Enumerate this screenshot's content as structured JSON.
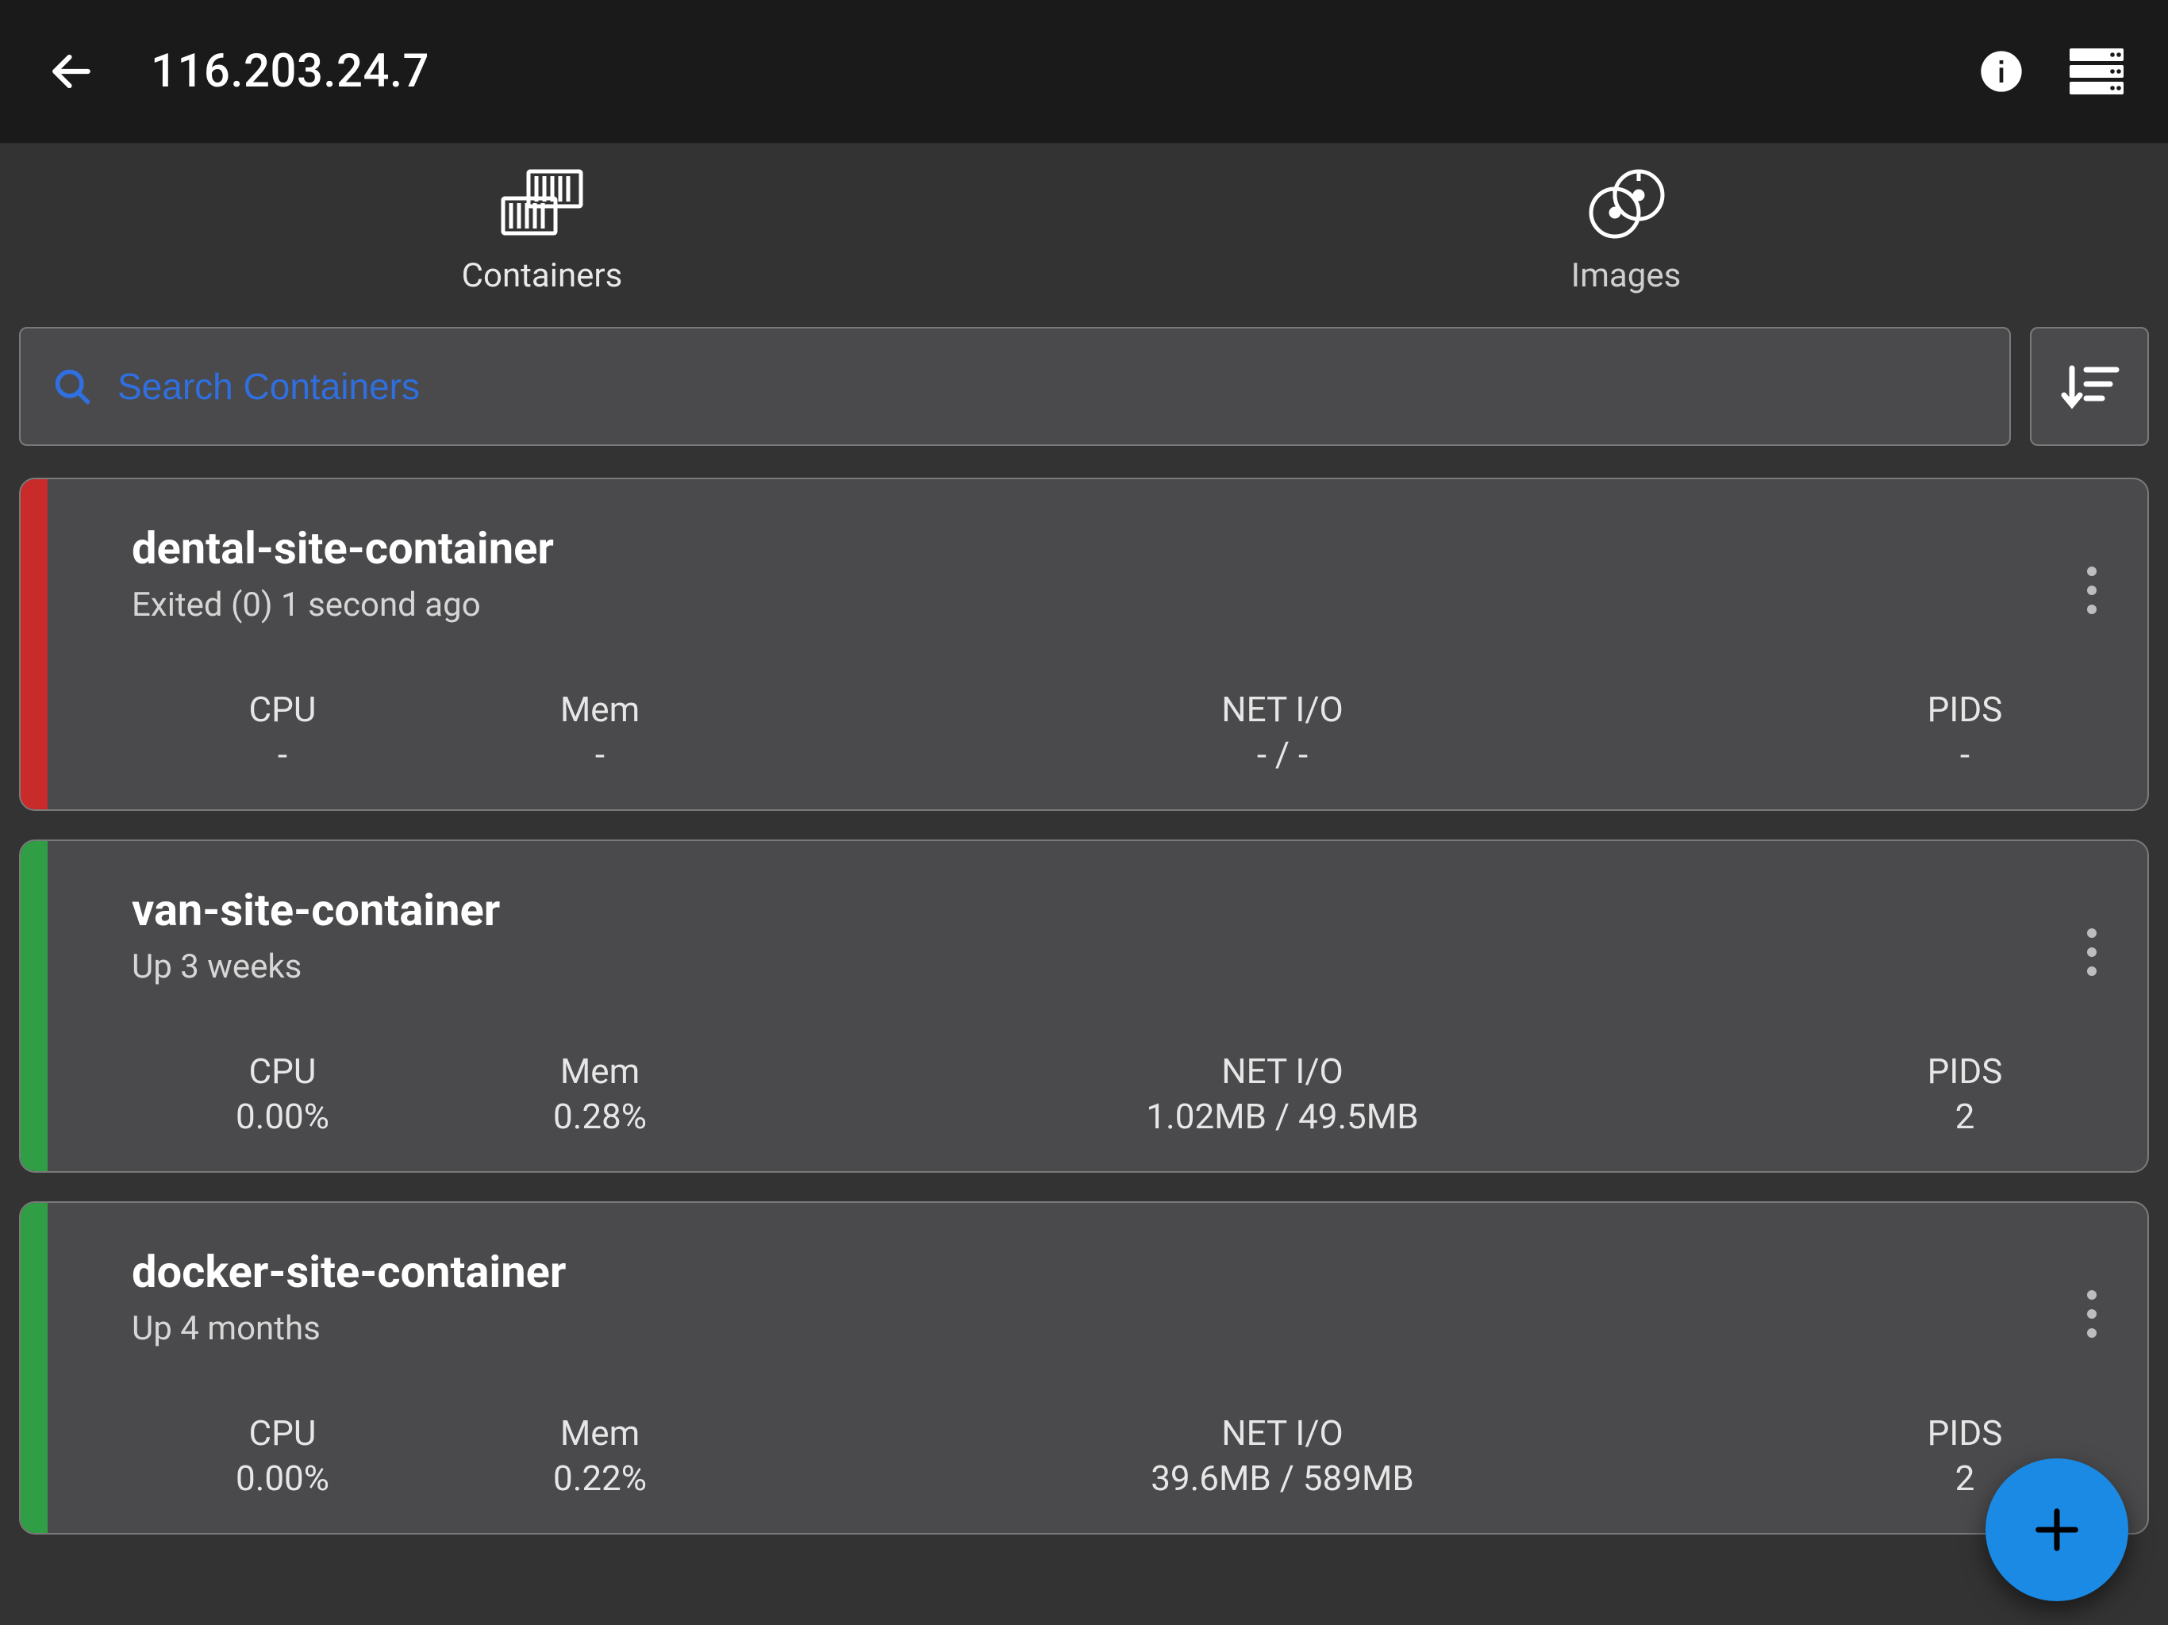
{
  "header": {
    "title": "116.203.24.7"
  },
  "tabs": {
    "containers_label": "Containers",
    "images_label": "Images",
    "active": "containers"
  },
  "search": {
    "placeholder": "Search Containers",
    "value": ""
  },
  "stat_labels": {
    "cpu": "CPU",
    "mem": "Mem",
    "netio": "NET I/O",
    "pids": "PIDS"
  },
  "colors": {
    "exited": "#c92a2a",
    "running": "#2f9e44",
    "accent": "#1a8ae5",
    "placeholder": "#2f6fe0"
  },
  "containers": [
    {
      "name": "dental-site-container",
      "status_text": "Exited (0) 1 second ago",
      "status_color_key": "exited",
      "cpu": "-",
      "mem": "-",
      "netio": "- / -",
      "pids": "-"
    },
    {
      "name": "van-site-container",
      "status_text": "Up 3 weeks",
      "status_color_key": "running",
      "cpu": "0.00%",
      "mem": "0.28%",
      "netio": "1.02MB / 49.5MB",
      "pids": "2"
    },
    {
      "name": "docker-site-container",
      "status_text": "Up 4 months",
      "status_color_key": "running",
      "cpu": "0.00%",
      "mem": "0.22%",
      "netio": "39.6MB / 589MB",
      "pids": "2"
    }
  ]
}
